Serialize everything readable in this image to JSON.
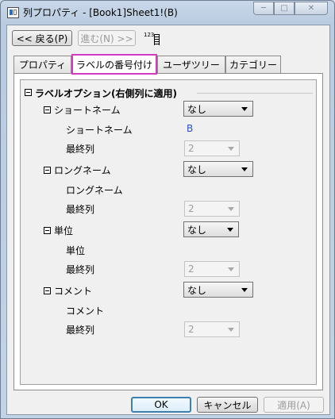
{
  "window": {
    "title": "列プロパティ - [Book1]Sheet1!(B)"
  },
  "toolbar": {
    "back_label": "<< 戻る(P)",
    "forward_label": "進む(N) >>",
    "numbering_icon_text": "123"
  },
  "tabs": [
    "プロパティ",
    "ラベルの番号付け",
    "ユーザツリー",
    "カテゴリー"
  ],
  "section": {
    "title": "ラベルオプション(右側列に適用)"
  },
  "groups": [
    {
      "label": "ショートネーム",
      "value": "なし",
      "sub_label": "ショートネーム",
      "sub_value": "B",
      "last_label": "最終列",
      "last_value": "2"
    },
    {
      "label": "ロングネーム",
      "value": "なし",
      "sub_label": "ロングネーム",
      "sub_value": "",
      "last_label": "最終列",
      "last_value": "2"
    },
    {
      "label": "単位",
      "value": "なし",
      "sub_label": "単位",
      "sub_value": "",
      "last_label": "最終列",
      "last_value": "2"
    },
    {
      "label": "コメント",
      "value": "なし",
      "sub_label": "コメント",
      "sub_value": "",
      "last_label": "最終列",
      "last_value": "2"
    }
  ],
  "footer": {
    "ok_label": "OK",
    "cancel_label": "キャンセル",
    "apply_label": "適用(A)"
  },
  "colors": {
    "tab_highlight": "#d23cc4",
    "value_blue": "#2a4fd8"
  }
}
